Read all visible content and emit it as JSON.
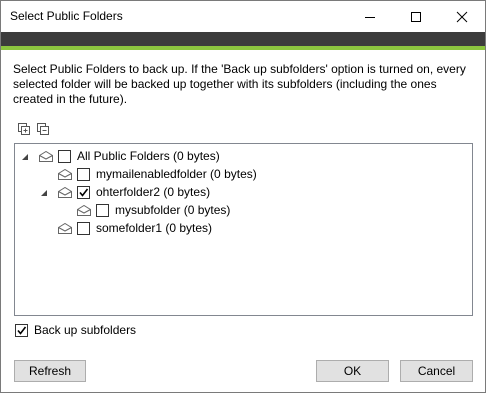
{
  "window": {
    "title": "Select Public Folders"
  },
  "description": "Select Public Folders to back up. If the 'Back up subfolders' option is turned on, every selected folder will be backed up together with its subfolders (including the ones created in the future).",
  "tree": {
    "items": [
      {
        "label": "All Public Folders (0 bytes)",
        "checked": false,
        "expanded": true
      },
      {
        "label": "mymailenabledfolder (0 bytes)",
        "checked": false
      },
      {
        "label": "ohterfolder2 (0 bytes)",
        "checked": true,
        "expanded": true
      },
      {
        "label": "mysubfolder (0 bytes)",
        "checked": false
      },
      {
        "label": "somefolder1 (0 bytes)",
        "checked": false
      }
    ]
  },
  "options": {
    "backup_subfolders_label": "Back up subfolders",
    "backup_subfolders_checked": true
  },
  "buttons": {
    "refresh": "Refresh",
    "ok": "OK",
    "cancel": "Cancel"
  },
  "colors": {
    "accent_dark": "#3c3c3c",
    "accent_green": "#8cc63f"
  }
}
